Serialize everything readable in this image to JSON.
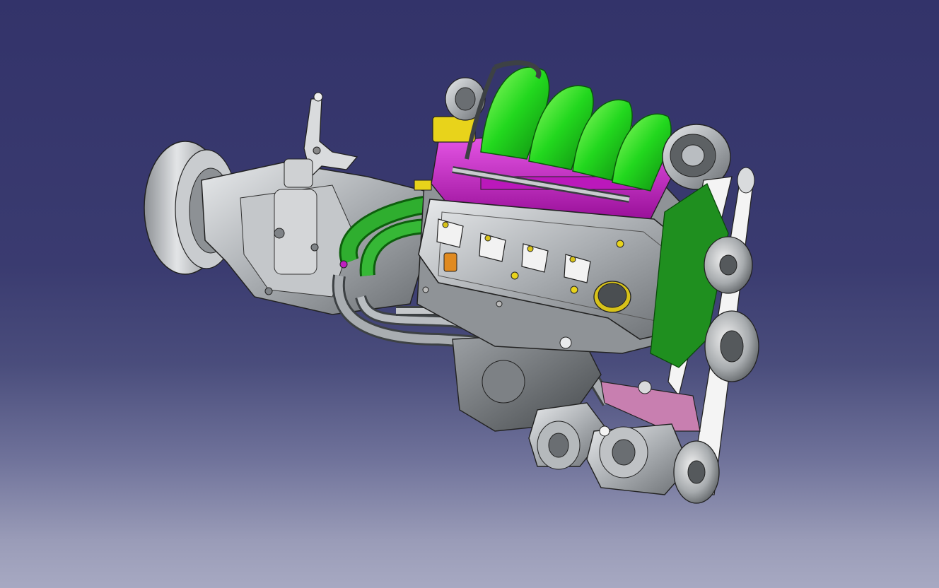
{
  "viewer": {
    "background_top": "#33336a",
    "background_bottom": "#a7a9c2"
  },
  "model": {
    "subject": "engine-and-transmission-assembly",
    "part_colors": {
      "intake_manifold": "#22e022",
      "manifold_base": "#d21fd2",
      "housing_metal": "#b8bcc0",
      "bracket_pink": "#c87fb0",
      "coolant_pipe": "#2fa52f",
      "throttle_body_yellow": "#e8d31b",
      "belt": "#f2f2f2",
      "dark_steel": "#6d7175"
    },
    "coil_packs": 4
  }
}
